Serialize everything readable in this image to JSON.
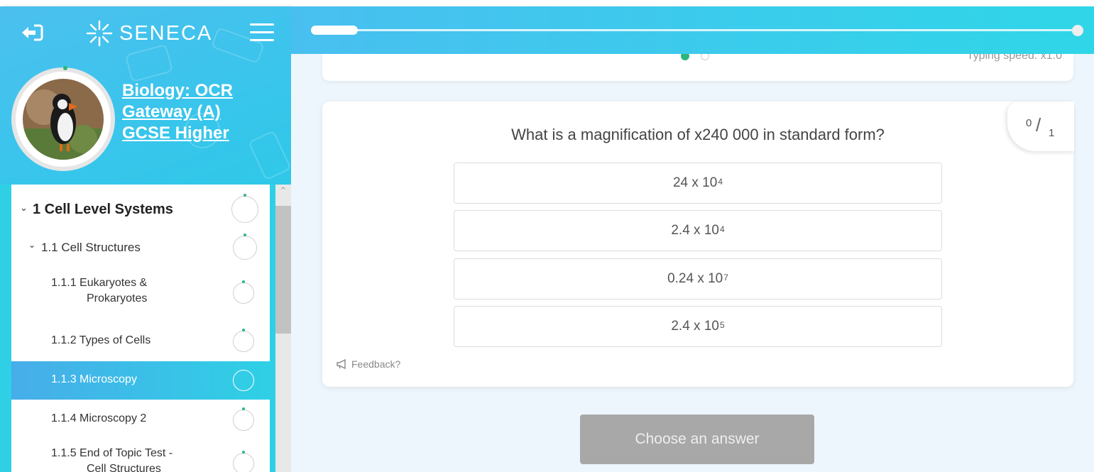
{
  "sidebar": {
    "logo_text": "SENECA",
    "course_title": "Biology: OCR Gateway (A) GCSE Higher",
    "items": [
      {
        "label": "1 Cell Level Systems",
        "level": 0
      },
      {
        "label": "1.1 Cell Structures",
        "level": 1
      },
      {
        "label": "1.1.1 Eukaryotes &",
        "label2": "Prokaryotes",
        "level": 2
      },
      {
        "label": "1.1.2 Types of Cells",
        "level": 2
      },
      {
        "label": "1.1.3 Microscopy",
        "level": 2,
        "active": true
      },
      {
        "label": "1.1.4 Microscopy 2",
        "level": 2
      },
      {
        "label": "1.1.5 End of Topic Test -",
        "label2": "Cell Structures",
        "level": 2
      }
    ]
  },
  "main": {
    "typing_speed": "Typing speed: x1.0",
    "score": {
      "numerator": "0",
      "denominator": "1"
    },
    "question": "What is a magnification of x240 000 in standard form?",
    "options": [
      {
        "base": "24 x 10",
        "exp": "4"
      },
      {
        "base": "2.4 x 10",
        "exp": "4"
      },
      {
        "base": "0.24 x 10",
        "exp": "7"
      },
      {
        "base": "2.4 x 10",
        "exp": "5"
      }
    ],
    "feedback_label": "Feedback?",
    "choose_button": "Choose an answer"
  },
  "colors": {
    "brand_gradient_start": "#49bff0",
    "brand_gradient_end": "#2fd6e8",
    "progress_green": "#2db77b",
    "disabled_button": "#a8a8a8"
  },
  "icons": [
    "back-arrow-icon",
    "seneca-logo-icon",
    "hamburger-menu-icon",
    "chevron-down-icon",
    "megaphone-icon",
    "progress-circle-icon"
  ]
}
